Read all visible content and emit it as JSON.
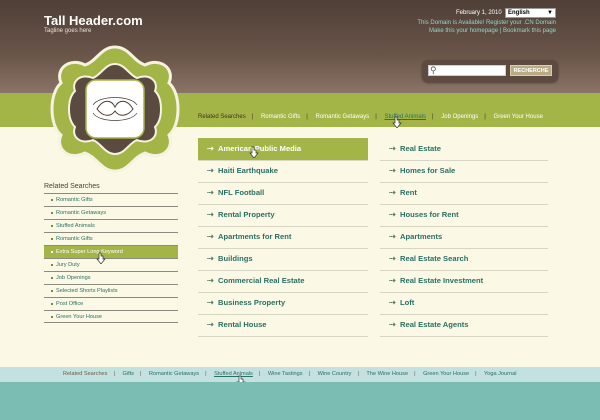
{
  "header": {
    "site_title": "Tall Header.com",
    "tagline": "Tagline goes here",
    "date": "February 1, 2010",
    "language": "English",
    "domain_notice": "This Domain is Available! Register your .CN Domain",
    "links": "Make this your homepage | Bookmark this page"
  },
  "search": {
    "placeholder": "",
    "button_label": "RECHERCHE"
  },
  "topnav": {
    "label": "Related Searches",
    "items": [
      "Romantic Gifts",
      "Romantic Getaways",
      "Stuffed Animals",
      "Job Openings",
      "Green Your House"
    ]
  },
  "sidebar": {
    "title": "Related Searches",
    "items": [
      "Romantic Gifts",
      "Romantic Getaways",
      "Stuffed Animals",
      "Romantic Gifts",
      "Extra Super Long Keyword",
      "Jury Duty",
      "Job Openings",
      "Selected Shorts Playlists",
      "Post Office",
      "Green Your House"
    ]
  },
  "main": {
    "left": [
      "American Public Media",
      "Haiti Earthquake",
      "NFL Football",
      "Rental Property",
      "Apartments for Rent",
      "Buildings",
      "Commercial Real Estate",
      "Business Property",
      "Rental House"
    ],
    "right": [
      "Real Estate",
      "Homes for Sale",
      "Rent",
      "Houses for Rent",
      "Apartments",
      "Real Estate Search",
      "Real Estate Investment",
      "Loft",
      "Real Estate Agents"
    ]
  },
  "footer": {
    "label": "Related Searches",
    "items": [
      "Gifts",
      "Romantic Getaways",
      "Stuffed Animals",
      "Wine Tastings",
      "Wine Country",
      "The Wine House",
      "Green Your House",
      "Yoga Journal"
    ]
  },
  "colors": {
    "brand_green": "#a4b548",
    "header_brown": "#5d4a40",
    "link_teal": "#2a6f63",
    "footer_teal": "#7bbdb3"
  }
}
